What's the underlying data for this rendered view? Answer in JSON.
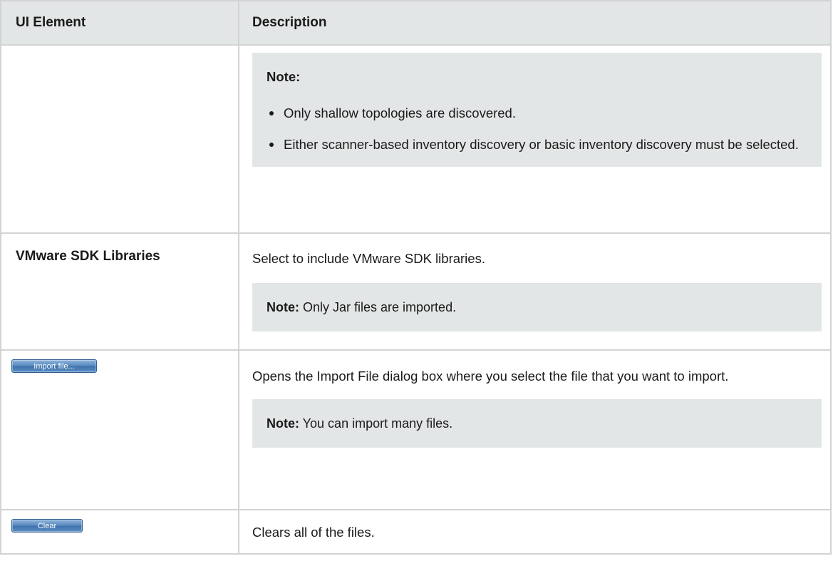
{
  "table": {
    "headers": {
      "ui_element": "UI Element",
      "description": "Description"
    },
    "rows": [
      {
        "element": "",
        "description": "",
        "note": {
          "heading": "Note:",
          "items": [
            "Only shallow topologies are discovered.",
            "Either scanner-based inventory discovery or basic inventory discovery must be selected."
          ]
        }
      },
      {
        "element": "VMware SDK Libraries",
        "description": "Select to include VMware SDK libraries.",
        "note": {
          "label": "Note:",
          "text": " Only Jar files are imported."
        }
      },
      {
        "element_button": "Import file...",
        "description": "Opens the Import File dialog box where you select the file that you want to import.",
        "note": {
          "label": "Note:",
          "text": " You can import many files."
        }
      },
      {
        "element_button": "Clear",
        "description": "Clears all of the files."
      }
    ]
  },
  "colors": {
    "header_bg": "#e3e6e6",
    "note_bg": "#e3e6e6",
    "border": "#d3d3d3",
    "button_blue": "#4f82b9"
  },
  "icons": {
    "bullet": "bullet-dot"
  }
}
